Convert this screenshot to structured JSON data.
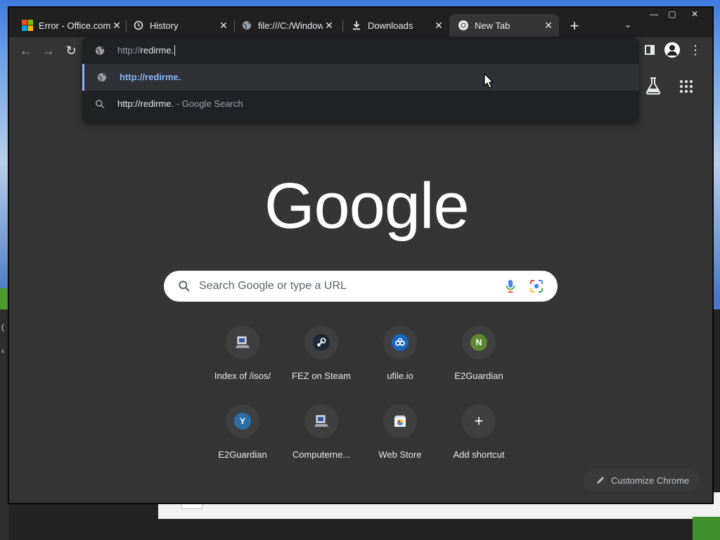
{
  "tabs": [
    {
      "title": "Error - Office.com",
      "favicon": "microsoft-logo",
      "active": false
    },
    {
      "title": "History",
      "favicon": "history-icon",
      "active": false
    },
    {
      "title": "file:///C:/Windows/",
      "favicon": "globe-icon",
      "active": false
    },
    {
      "title": "Downloads",
      "favicon": "download-icon",
      "active": false
    },
    {
      "title": "New Tab",
      "favicon": "chrome-icon",
      "active": true
    }
  ],
  "tab_close_glyph": "✕",
  "new_tab_glyph": "+",
  "tab_search_glyph": "⌄",
  "window_controls": {
    "minimize": "—",
    "maximize": "▢",
    "close": "✕"
  },
  "nav": {
    "back": "←",
    "forward": "→",
    "reload": "↻",
    "menu": "⋮"
  },
  "omnibox": {
    "scheme": "http://",
    "host": "redirme.",
    "suggestions": [
      {
        "type": "url",
        "icon": "globe-icon",
        "text": "http://redirme.",
        "selected": true
      },
      {
        "type": "search",
        "icon": "search-icon",
        "text": "http://redirme.",
        "suffix": " - Google Search",
        "selected": false
      }
    ]
  },
  "ntp": {
    "logo_text": "Google",
    "search_placeholder": "Search Google or type a URL",
    "shortcuts": [
      {
        "label": "Index of /isos/",
        "icon": "computer-icon"
      },
      {
        "label": "FEZ on Steam",
        "icon": "steam-icon"
      },
      {
        "label": "ufile.io",
        "icon": "ufile-icon"
      },
      {
        "label": "E2Guardian",
        "icon": "letter-n-icon",
        "letter": "N",
        "color": "#5b8a2e"
      },
      {
        "label": "E2Guardian",
        "icon": "letter-y-icon",
        "letter": "Y",
        "color": "#2a6fa8"
      },
      {
        "label": "Computerne...",
        "icon": "computer-icon"
      },
      {
        "label": "Web Store",
        "icon": "webstore-icon"
      },
      {
        "label": "Add shortcut",
        "icon": "plus-icon",
        "glyph": "+"
      }
    ],
    "customize_label": "Customize Chrome"
  },
  "colors": {
    "accent_blue": "#8ab4f8",
    "frame": "#202020",
    "surface": "#353535"
  }
}
